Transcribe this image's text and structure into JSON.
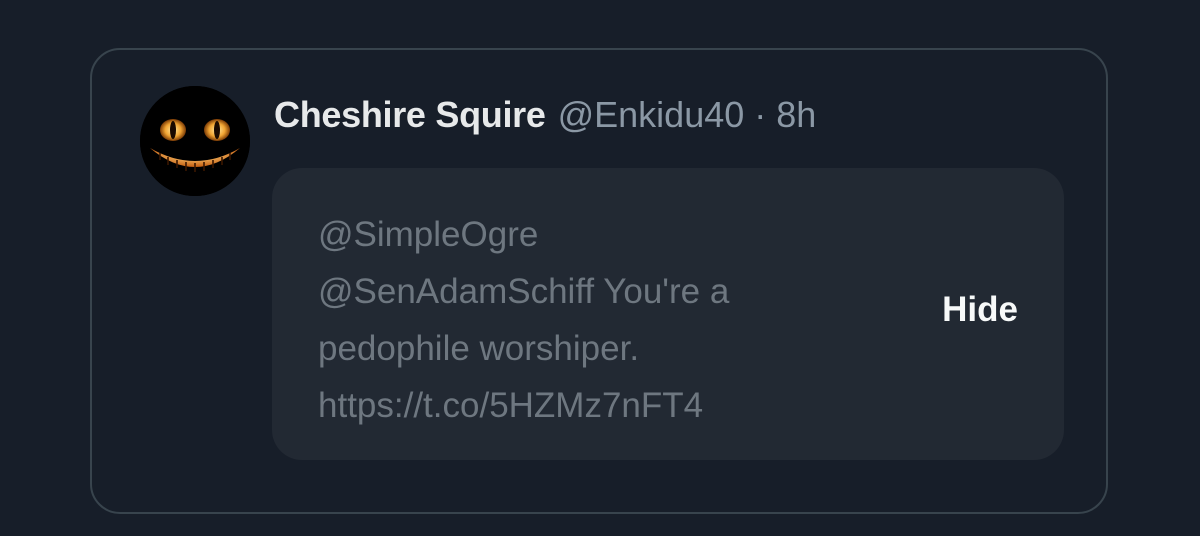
{
  "tweet": {
    "display_name": "Cheshire Squire",
    "handle": "@Enkidu40",
    "separator": "·",
    "timestamp": "8h",
    "avatar_icon": "cheshire-cat-grin-icon"
  },
  "hidden_reply": {
    "lines": [
      "@SimpleOgre",
      "@SenAdamSchiff You're a",
      "pedophile worshiper.",
      "https://t.co/5HZMz7nFT4"
    ],
    "hide_label": "Hide"
  },
  "colors": {
    "background": "#171e29",
    "card_border": "#38444d",
    "reply_background": "#222933",
    "primary_text": "#e7e9ea",
    "secondary_text": "#8b98a5",
    "muted_text": "#6e7780"
  }
}
